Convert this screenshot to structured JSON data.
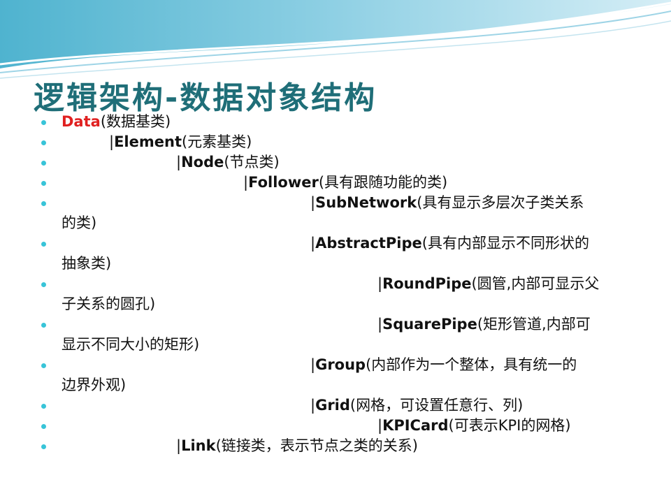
{
  "slide": {
    "title": "逻辑架构-数据对象结构",
    "accent_color": "#1f6e78",
    "bullet_color": "#38c4d8",
    "items": [
      {
        "prefix": "",
        "name": "Data",
        "desc": "(数据基类)",
        "cont": ""
      },
      {
        "prefix": "|",
        "name": "Element",
        "desc": "(元素基类)",
        "cont": ""
      },
      {
        "prefix": "|",
        "name": "Node",
        "desc": "(节点类)",
        "cont": ""
      },
      {
        "prefix": "|",
        "name": "Follower",
        "desc": "(具有跟随功能的类)",
        "cont": ""
      },
      {
        "prefix": "|",
        "name": "SubNetwork",
        "desc": "(具有显示多层次子类关系",
        "cont": "的类)"
      },
      {
        "prefix": "|",
        "name": "AbstractPipe",
        "desc": "(具有内部显示不同形状的",
        "cont": "抽象类)"
      },
      {
        "prefix": "|",
        "name": "RoundPipe",
        "desc": "(圆管,内部可显示父",
        "cont": "子关系的圆孔)"
      },
      {
        "prefix": "|",
        "name": "SquarePipe",
        "desc": "(矩形管道,内部可",
        "cont": "显示不同大小的矩形)"
      },
      {
        "prefix": "|",
        "name": "Group",
        "desc": "(内部作为一个整体，具有统一的",
        "cont": "边界外观)"
      },
      {
        "prefix": "|",
        "name": "Grid",
        "desc": "(网格，可设置任意行、列)",
        "cont": ""
      },
      {
        "prefix": "|",
        "name": "KPICard",
        "desc": "(可表示KPI的网格)",
        "cont": ""
      },
      {
        "prefix": "|",
        "name": "Link",
        "desc": "(链接类，表示节点之类的关系)",
        "cont": ""
      }
    ]
  }
}
